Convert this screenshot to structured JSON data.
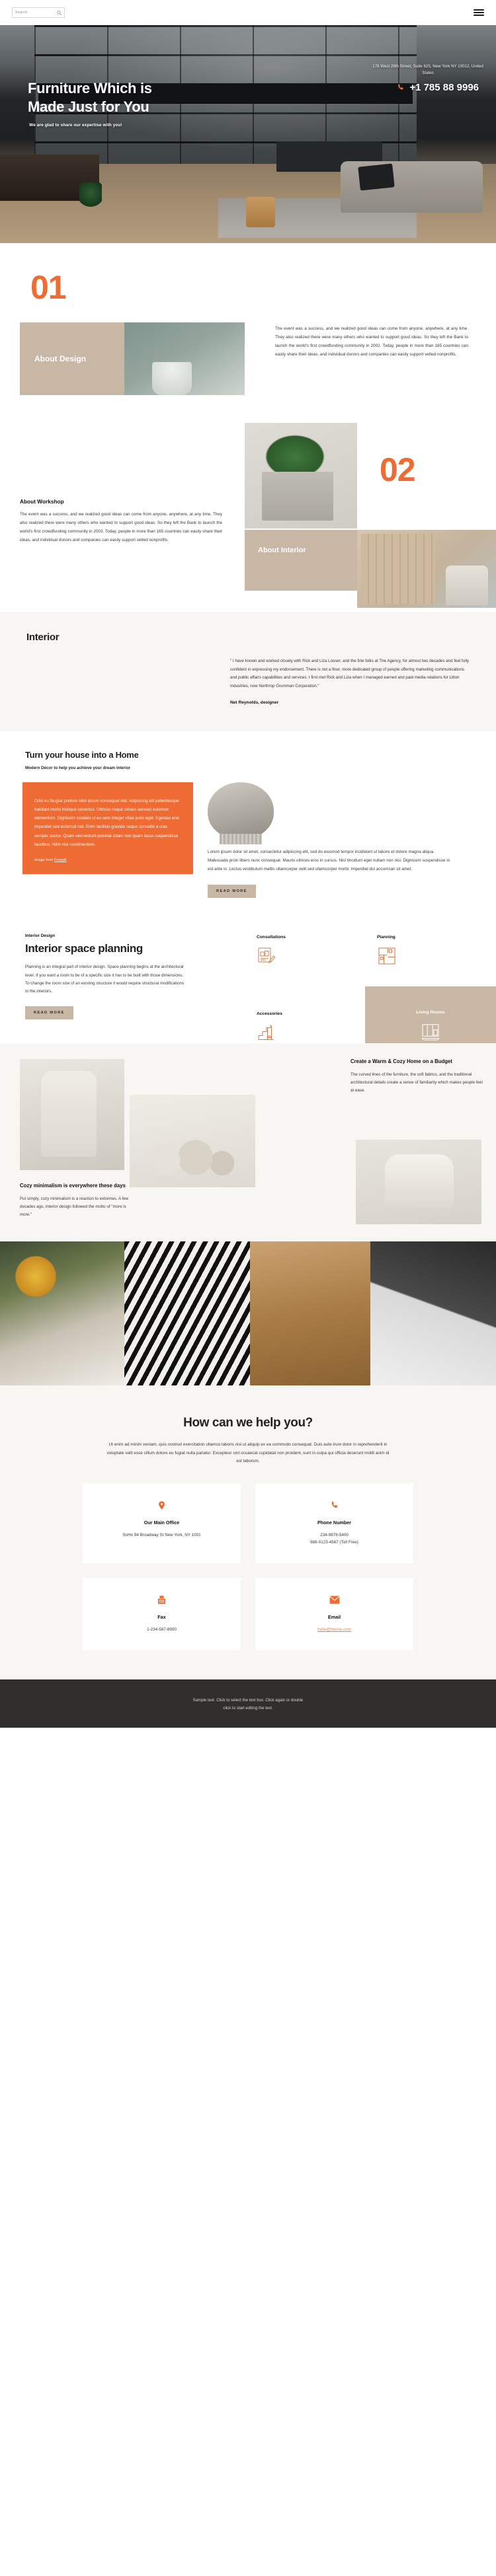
{
  "header": {
    "search_placeholder": "Search",
    "search_icon": "search-icon",
    "menu_icon": "hamburger-menu-icon"
  },
  "hero": {
    "title_line1": "Furniture Which is",
    "title_line2": "Made Just for You",
    "subtitle": "We are glad to share our expertise with you!",
    "address": "178 West 28th Street, Suite 625, New York NY 10012, United States",
    "phone": "+1 785 88 9996",
    "phone_icon": "phone-icon"
  },
  "section01": {
    "number": "01",
    "overlay_title": "About Design",
    "body": "The event was a success, and we realized good ideas can come from anyone, anywhere, at any time. They also realized there were many others who wanted to support good ideas. So they left the Bank to launch the world's first crowdfunding community in 2002. Today, people in more than 165 countries can easily share their ideas, and individual donors and companies can easily support vetted nonprofits."
  },
  "section02": {
    "number": "02",
    "overlay_title": "About Interior",
    "heading": "About Workshop",
    "body": "The event was a success, and we realized good ideas can come from anyone, anywhere, at any time. They also realized there were many others who wanted to support good ideas. So they left the Bank to launch the world's first crowdfunding community in 2002. Today, people in more than 165 countries can easily share their ideas, and individual donors and companies can easily support vetted nonprofits."
  },
  "interior": {
    "heading": "Interior",
    "quote": "\" I have known and worked closely with Rick and Liza Looser, and the fine folks at The Agency, for almost two decades and feel fully confident in expressing my endorsement. There is not a finer, more dedicated group of people offering marketing communications and public affairs capabilities and services. I first met Rick and Liza when I managed earned and paid media relations for Litton Industries, now Northrop Grumman Corporation.\"",
    "author": "Net Reynolds, designer"
  },
  "turn": {
    "heading": "Turn your house into a Home",
    "subtitle": "Modern Décor to help you achieve your dream interior",
    "orange_body": "Odio eu feugiat pretium nibh ipsum consequat nisl. Adipiscing elit pellentesque habitant morbi tristique senectus. Ultrices neque ornare aenean euismod elementum. Dignissim sodales ut eu sem integer vitae justo eget. Egestas erat imperdiet sed euismod nisi. Enim facilisis gravida neque convallis a cras semper auctor. Quam elementum pulvinar etiam non quam lacus suspendisse faucibus. Nibh nisl condimentum.",
    "credit_prefix": "Image from ",
    "credit_link": "Freepik",
    "right_body": "Lorem ipsum dolor sit amet, consectetur adipiscing elit, sed do eiusmod tempor incididunt ut labore et dolore magna aliqua. Malesuada proin libero nunc consequat. Mauris ultrices eros in cursus. Nisl tincidunt eget nullam non nisi. Dignissim suspendisse in est ante in. Lectus vestibulum mattis ullamcorper velit sed ullamcorper morbi. Imperdiet dui accumsan sit amet.",
    "read_more": "READ MORE"
  },
  "planning": {
    "eyebrow": "Interior Design",
    "heading": "Interior space planning",
    "body": "Planning is an integral part of interior design. Space planning begins at the architectural level. If you want a room to be of a specific size it has to be built with those dimensions. To change the room size of an existing structure it would require structural modifications to the interiors.",
    "read_more": "READ MORE",
    "services": [
      {
        "label": "Consultations",
        "icon": "consultation-sketch-icon"
      },
      {
        "label": "Planning",
        "icon": "floorplan-icon"
      },
      {
        "label": "Accessories",
        "icon": "stairs-plant-icon"
      },
      {
        "label": "Living Rooms",
        "icon": "living-room-icon"
      }
    ]
  },
  "gallery": {
    "warm_heading": "Create a Warm & Cozy Home on a Budget",
    "warm_body": "The curved lines of the furniture, the soft fabrics, and the traditional architectural details create a sense of familiarity which makes people feel at ease.",
    "min_heading": "Cozy minimalism is everywhere these days",
    "min_body": "Put simply, cozy minimalism is a reaction to extremes. A few decades ago, interior design followed the motto of \"more is more.\""
  },
  "help": {
    "heading": "How can we help you?",
    "body": "Ut enim ad minim veniam, quis nostrud exercitation ullamco laboris nisi ut aliquip ex ea commodo consequat. Duis aute irure dolor in reprehenderit in voluptate velit esse cillum dolore eu fugiat nulla pariatur. Excepteur sint occaecat cupidatat non proident, sunt in culpa qui officia deserunt mollit anim id est laborum.",
    "cards": [
      {
        "icon": "location-pin-icon",
        "title": "Our Main Office",
        "line1": "SoHo 94 Broadway St New York, NY 1001",
        "line2": ""
      },
      {
        "icon": "phone-icon",
        "title": "Phone Number",
        "line1": "234-9876-5400",
        "line2": "888-0123-4567 (Toll Free)"
      },
      {
        "icon": "fax-icon",
        "title": "Fax",
        "line1": "1-234-567-8900",
        "line2": ""
      },
      {
        "icon": "envelope-icon",
        "title": "Email",
        "line1": "hello@theme.com",
        "line2": ""
      }
    ]
  },
  "footer": {
    "line1": "Sample text. Click to select the text box. Click again or double",
    "line2": "click to start editing the text."
  },
  "colors": {
    "accent": "#ee6b33",
    "tan": "#c9b7a6",
    "dark": "#302f2d",
    "cream": "#f7f6f2"
  }
}
